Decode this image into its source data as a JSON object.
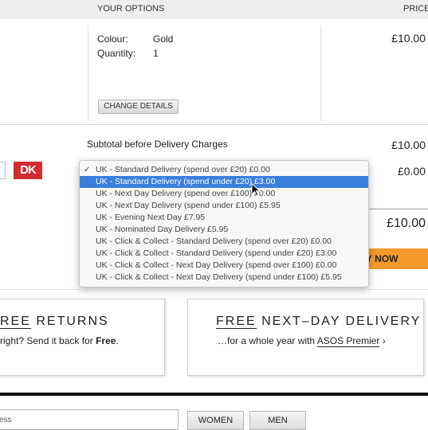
{
  "header": {
    "options_label": "YOUR OPTIONS",
    "price_label": "PRICE"
  },
  "item": {
    "colour_label": "Colour:",
    "colour_value": "Gold",
    "quantity_label": "Quantity:",
    "quantity_value": "1",
    "change_details_label": "CHANGE DETAILS",
    "price": "£10.00"
  },
  "subtotal": {
    "label": "Subtotal before Delivery Charges",
    "value": "£10.00"
  },
  "delivery": {
    "logo_text": "DK",
    "charge": "£0.00",
    "options": [
      "UK - Standard Delivery (spend over £20) £0.00",
      "UK - Standard Delivery (spend under £20) £3.00",
      "UK - Next Day Delivery (spend over £100) £0.00",
      "UK - Next Day Delivery (spend under £100) £5.95",
      "UK - Evening Next Day £7.95",
      "UK - Nominated Day Delivery £5.95",
      "UK - Click & Collect - Standard Delivery (spend over £20) £0.00",
      "UK - Click & Collect - Standard Delivery (spend under £20) £3.00",
      "UK - Click & Collect - Next Day Delivery (spend over £100) £0.00",
      "UK - Click & Collect - Next Day Delivery (spend under £100) £5.95"
    ],
    "checked_index": 0,
    "highlighted_index": 1
  },
  "total": {
    "value": "£10.00",
    "buy_label": "Y NOW"
  },
  "promos": {
    "returns": {
      "title_free": "REE",
      "title_rest": " RETURNS",
      "sub_pre": "right? Send it back for ",
      "sub_bold": "Free",
      "sub_post": "."
    },
    "nextday": {
      "title_free": "FREE",
      "title_rest": " NEXT–DAY DELIVERY",
      "sub_pre": "…for a whole year with ",
      "sub_link": "ASOS Premier",
      "sub_post": " ›"
    }
  },
  "footer": {
    "input_value": "ess",
    "women_label": "WOMEN",
    "men_label": "MEN"
  },
  "colors": {
    "accent_orange": "#f39a2b",
    "select_blue": "#3b7fdc",
    "dk_red": "#d22b30"
  }
}
